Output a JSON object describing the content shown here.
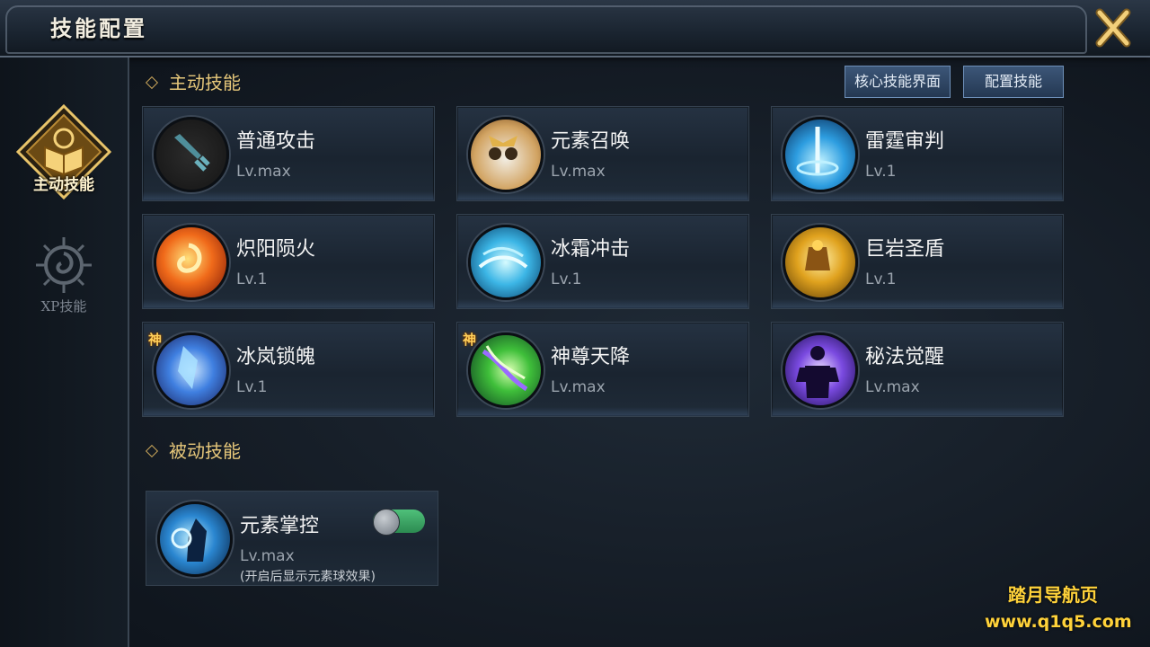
{
  "window": {
    "title": "技能配置",
    "close_icon": "close-x-icon"
  },
  "sidebar": {
    "tabs": [
      {
        "label": "主动技能",
        "icon": "book-emblem-icon",
        "active": true
      },
      {
        "label": "XP技能",
        "icon": "spiral-emblem-icon",
        "active": false
      }
    ]
  },
  "active_section": {
    "title": "主动技能"
  },
  "buttons": {
    "core": "核心技能界面",
    "configure": "配置技能"
  },
  "skills": [
    {
      "name": "普通攻击",
      "level": "Lv.max",
      "icon": "sword-icon"
    },
    {
      "name": "元素召唤",
      "level": "Lv.max",
      "icon": "owl-summon-icon"
    },
    {
      "name": "雷霆审判",
      "level": "Lv.1",
      "icon": "thunder-icon"
    },
    {
      "name": "炽阳陨火",
      "level": "Lv.1",
      "icon": "fire-swirl-icon"
    },
    {
      "name": "冰霜冲击",
      "level": "Lv.1",
      "icon": "frost-burst-icon"
    },
    {
      "name": "巨岩圣盾",
      "level": "Lv.1",
      "icon": "rock-shield-icon"
    },
    {
      "name": "冰岚锁魄",
      "level": "Lv.1",
      "icon": "ice-crystal-icon",
      "badge": "神"
    },
    {
      "name": "神尊天降",
      "level": "Lv.max",
      "icon": "green-vortex-icon",
      "badge": "神"
    },
    {
      "name": "秘法觉醒",
      "level": "Lv.max",
      "icon": "arcane-figure-icon"
    }
  ],
  "passive_section": {
    "title": "被动技能"
  },
  "passive": {
    "name": "元素掌控",
    "level": "Lv.max",
    "note": "(开启后显示元素球效果)",
    "icon": "element-mage-icon",
    "toggle_on": true
  },
  "watermark": {
    "line1": "踏月导航页",
    "line2": "www.q1q5.com"
  },
  "colors": {
    "accent_gold": "#e6c77a",
    "toggle_green": "#4fc07a",
    "button_blue": "#3c5678"
  }
}
